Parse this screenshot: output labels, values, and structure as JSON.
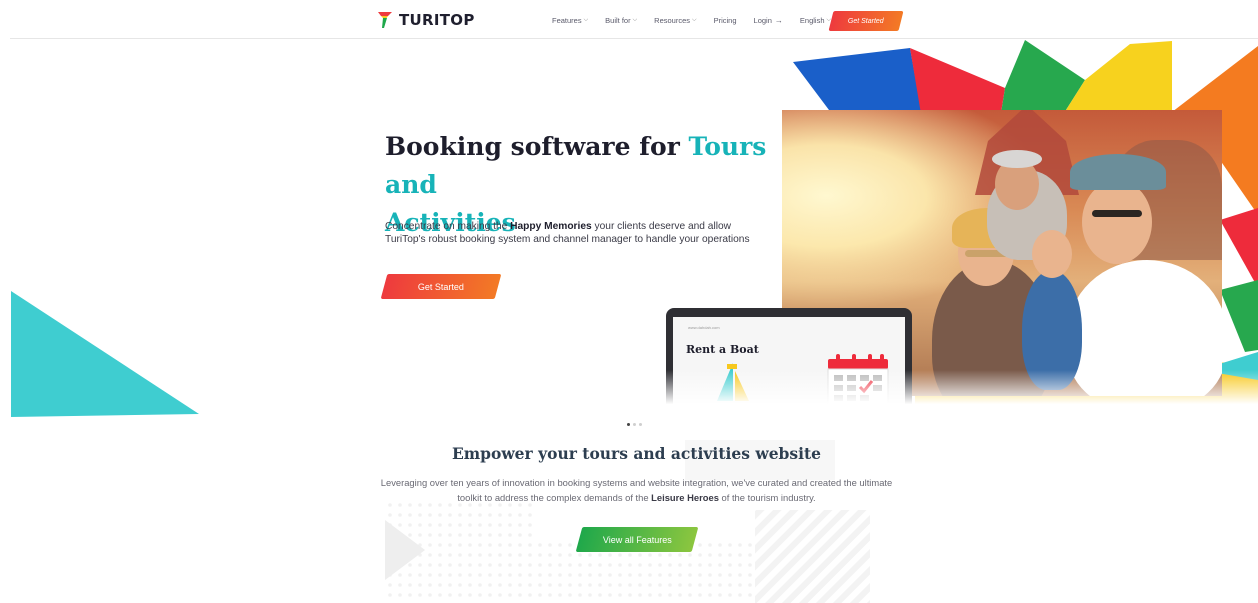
{
  "brand": {
    "name": "TURITOP"
  },
  "nav": {
    "items": [
      {
        "label": "Features",
        "has_dropdown": true
      },
      {
        "label": "Built for",
        "has_dropdown": true
      },
      {
        "label": "Resources",
        "has_dropdown": true
      },
      {
        "label": "Pricing",
        "has_dropdown": false
      },
      {
        "label": "Login",
        "has_arrow": true
      },
      {
        "label": "English",
        "has_dropdown": true
      }
    ],
    "cta_label": "Get Started"
  },
  "hero": {
    "title_part1": "Booking software for ",
    "title_accent_line1": "Tours and",
    "title_accent_line2": "Activities",
    "desc_before": "Concentrate on making the ",
    "desc_bold": "Happy Memories",
    "desc_after": " your clients deserve and allow TuriTop's robust booking system and channel manager to handle your operations",
    "cta_label": "Get Started",
    "laptop_url": "www.dahdah.com",
    "laptop_heading": "Rent a Boat"
  },
  "carousel": {
    "count": 3,
    "active": 0
  },
  "features": {
    "title": "Empower your tours and activities website",
    "desc_before": "Leveraging over ten years of innovation in booking systems and website integration, we've curated and created the ultimate toolkit to address the complex demands of the ",
    "desc_bold": "Leisure Heroes",
    "desc_after": " of the tourism industry.",
    "cta_label": "View all Features"
  },
  "colors": {
    "accent_teal": "#17b3b8",
    "cta_orange_start": "#ee3a3e",
    "cta_orange_end": "#f37a25",
    "cta_green_start": "#1fa84b",
    "cta_green_end": "#8cc63f",
    "heading_dark": "#1e1e2c"
  }
}
